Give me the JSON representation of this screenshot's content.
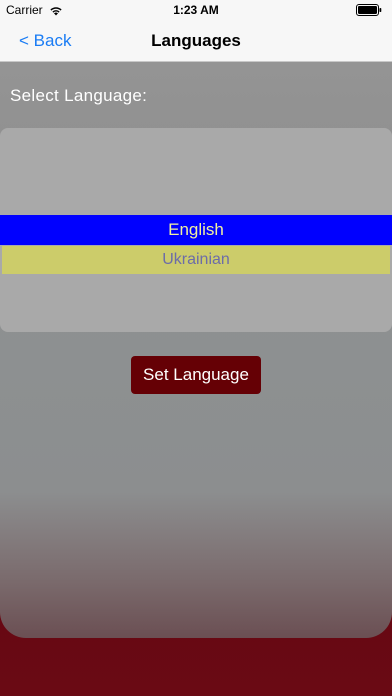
{
  "status_bar": {
    "carrier": "Carrier",
    "time": "1:23 AM",
    "wifi_icon": "wifi-icon",
    "battery_icon": "battery-icon"
  },
  "nav": {
    "back_label": "< Back",
    "title": "Languages"
  },
  "main": {
    "select_label": "Select Language:",
    "picker": {
      "options": [
        "English",
        "Ukrainian"
      ],
      "selected": "English"
    },
    "set_button_label": "Set Language"
  },
  "colors": {
    "accent_blue": "#1a7cf4",
    "selected_row_bg": "#0000ff",
    "selected_row_text": "#f0f0a0",
    "other_row_bg": "#cccc6a",
    "other_row_text": "#6c6ca8",
    "button_bg": "#650005",
    "footer_bg": "#4a0008"
  }
}
